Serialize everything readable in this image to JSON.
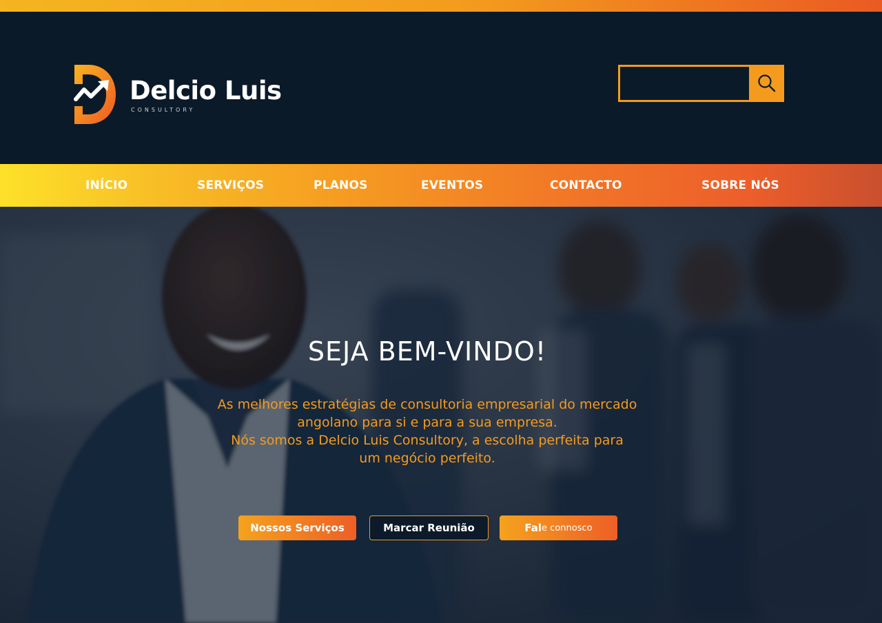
{
  "brand": {
    "name": "Delcio Luis",
    "tagline": "CONSULTORY"
  },
  "search": {
    "placeholder": "",
    "icon": "search-icon"
  },
  "nav": {
    "items": [
      {
        "label": "INÍCIO"
      },
      {
        "label": "SERVIÇOS"
      },
      {
        "label": "PLANOS"
      },
      {
        "label": "EVENTOS"
      },
      {
        "label": "CONTACTO"
      },
      {
        "label": "SOBRE NÓS"
      }
    ]
  },
  "hero": {
    "title": "SEJA BEM-VINDO!",
    "subtitle_lines": [
      "As melhores estratégias de consultoria empresarial do mercado",
      "angolano para si e para a sua empresa.",
      "Nós somos a Delcio Luis Consultory, a escolha perfeita para",
      "um negócio perfeito."
    ],
    "buttons": {
      "services": "Nossos Serviços",
      "meeting": "Marcar Reunião",
      "contact_bold": "Fal",
      "contact_rest": "e connosco"
    }
  },
  "colors": {
    "navy": "#0b1a29",
    "orange": "#f49b1e",
    "yellow": "#fde129",
    "red_orange": "#ec5e2a"
  }
}
